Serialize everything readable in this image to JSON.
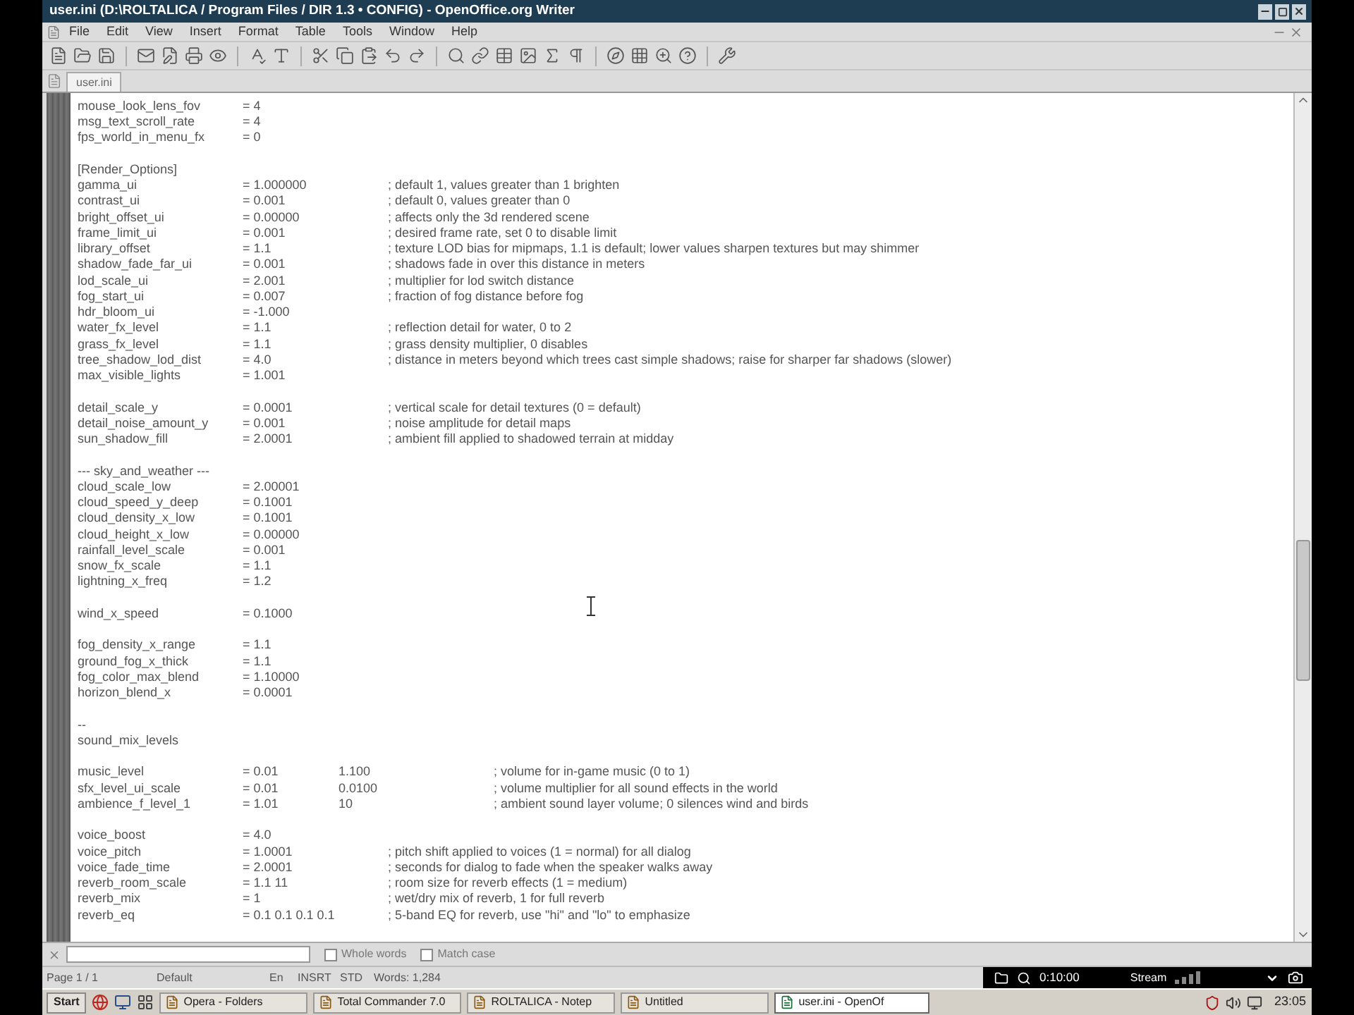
{
  "window": {
    "title": "user.ini (D:\\ROLTALICA / Program Files / DIR 1.3 • CONFIG) - OpenOffice.org Writer"
  },
  "menu": [
    "File",
    "Edit",
    "View",
    "Insert",
    "Format",
    "Table",
    "Tools",
    "Window",
    "Help"
  ],
  "tabs": [
    {
      "label": "user.ini",
      "selected": true
    }
  ],
  "document": {
    "blocks": [
      {
        "lines": [
          {
            "kind": "setting",
            "key": "mouse_look_lens_fov",
            "value": "= 4"
          },
          {
            "kind": "setting",
            "key": "msg_text_scroll_rate",
            "value": "= 4"
          },
          {
            "kind": "setting",
            "key": "fps_world_in_menu_fx",
            "value": "= 0"
          }
        ]
      },
      {
        "lines": [
          {
            "kind": "header",
            "text": "[Render_Options]"
          },
          {
            "kind": "setting",
            "key": "gamma_ui",
            "value": "= 1.000000",
            "comment": "; default 1, values greater than 1 brighten"
          },
          {
            "kind": "setting",
            "key": "contrast_ui",
            "value": "= 0.001",
            "comment": "; default 0, values greater than 0"
          },
          {
            "kind": "setting",
            "key": "bright_offset_ui",
            "value": "= 0.00000",
            "comment": "; affects only the 3d rendered scene"
          },
          {
            "kind": "setting",
            "key": "frame_limit_ui",
            "value": "= 0.001",
            "comment": "; desired frame rate, set 0 to disable limit"
          },
          {
            "kind": "setting",
            "key": "library_offset",
            "value": "= 1.1",
            "comment": "; texture LOD bias for mipmaps, 1.1 is default; lower values sharpen textures but may shimmer"
          },
          {
            "kind": "setting",
            "key": "shadow_fade_far_ui",
            "value": "= 0.001",
            "comment": "; shadows fade in over this distance in meters"
          },
          {
            "kind": "setting",
            "key": "lod_scale_ui",
            "value": "= 2.001",
            "comment": "; multiplier for lod switch distance"
          },
          {
            "kind": "setting",
            "key": "fog_start_ui",
            "value": "= 0.007",
            "comment": "; fraction of fog distance before fog"
          },
          {
            "kind": "setting",
            "key": "hdr_bloom_ui",
            "value": "= -1.000"
          },
          {
            "kind": "setting",
            "key": "water_fx_level",
            "value": "= 1.1",
            "comment": "; reflection detail for water, 0 to 2"
          },
          {
            "kind": "setting",
            "key": "grass_fx_level",
            "value": "= 1.1",
            "comment": "; grass density multiplier, 0 disables"
          },
          {
            "kind": "setting",
            "key": "tree_shadow_lod_dist",
            "value": "= 4.0",
            "comment": "; distance in meters beyond which trees cast simple shadows; raise for sharper far shadows (slower)"
          },
          {
            "kind": "setting",
            "key": "max_visible_lights",
            "value": "= 1.001"
          }
        ]
      },
      {
        "lines": [
          {
            "kind": "setting",
            "key": "detail_scale_y",
            "value": "= 0.0001",
            "comment": "; vertical scale for detail textures (0 = default)"
          },
          {
            "kind": "setting",
            "key": "detail_noise_amount_y",
            "value": "= 0.001",
            "comment": "; noise amplitude for detail maps"
          },
          {
            "kind": "setting",
            "key": "sun_shadow_fill",
            "value": "= 2.0001",
            "comment": "; ambient fill applied to shadowed terrain at midday"
          }
        ]
      },
      {
        "lines": [
          {
            "kind": "text",
            "text": "--- sky_and_weather ---"
          },
          {
            "kind": "setting",
            "key": "cloud_scale_low",
            "value": "= 2.00001"
          },
          {
            "kind": "setting",
            "key": "cloud_speed_y_deep",
            "value": "= 0.1001"
          },
          {
            "kind": "setting",
            "key": "cloud_density_x_low",
            "value": "= 0.1001"
          },
          {
            "kind": "setting",
            "key": "cloud_height_x_low",
            "value": "= 0.00000"
          },
          {
            "kind": "setting",
            "key": "rainfall_level_scale",
            "value": "= 0.001"
          },
          {
            "kind": "setting",
            "key": "snow_fx_scale",
            "value": "= 1.1"
          },
          {
            "kind": "setting",
            "key": "lightning_x_freq",
            "value": "= 1.2"
          }
        ]
      },
      {
        "lines": [
          {
            "kind": "setting",
            "key": "wind_x_speed",
            "value": "= 0.1000"
          }
        ]
      },
      {
        "lines": [
          {
            "kind": "setting",
            "key": "fog_density_x_range",
            "value": "= 1.1"
          },
          {
            "kind": "setting",
            "key": "ground_fog_x_thick",
            "value": "= 1.1"
          },
          {
            "kind": "setting",
            "key": "fog_color_max_blend",
            "value": "= 1.10000"
          },
          {
            "kind": "setting",
            "key": "horizon_blend_x",
            "value": "= 0.0001"
          }
        ]
      },
      {
        "lines": [
          {
            "kind": "text",
            "text": "--"
          },
          {
            "kind": "text",
            "text": "sound_mix_levels"
          }
        ]
      },
      {
        "lines": [
          {
            "kind": "setting",
            "key": "music_level",
            "value": "= 0.01",
            "extra": "1.100",
            "comment": "; volume for in-game music (0 to 1)"
          },
          {
            "kind": "setting",
            "key": "sfx_level_ui_scale",
            "value": "= 0.01",
            "extra": "0.0100",
            "comment": "; volume multiplier for all sound effects in the world"
          },
          {
            "kind": "setting",
            "key": "ambience_f_level_1",
            "value": "= 1.01",
            "extra": "10",
            "comment": "; ambient sound layer volume; 0 silences wind and birds"
          }
        ]
      },
      {
        "lines": [
          {
            "kind": "setting",
            "key": "voice_boost",
            "value": "= 4.0"
          },
          {
            "kind": "setting",
            "key": "voice_pitch",
            "value": "= 1.0001",
            "comment": "; pitch shift applied to voices (1 = normal) for all dialog"
          },
          {
            "kind": "setting",
            "key": "voice_fade_time",
            "value": "= 2.0001",
            "comment": "; seconds for dialog to fade when the speaker walks away"
          },
          {
            "kind": "setting",
            "key": "reverb_room_scale",
            "value": "= 1.1  11",
            "comment": "; room size for reverb effects (1 = medium)"
          },
          {
            "kind": "setting",
            "key": "reverb_mix",
            "value": "= 1",
            "comment": "; wet/dry mix of reverb, 1 for full reverb"
          },
          {
            "kind": "setting",
            "key": "reverb_eq",
            "value": "= 0.1 0.1 0.1 0.1",
            "comment": "; 5-band EQ for reverb, use \"hi\" and \"lo\" to emphasize"
          }
        ]
      }
    ]
  },
  "find_bar": {
    "options": [
      {
        "label": "Whole words",
        "checked": false
      },
      {
        "label": "Match case",
        "checked": false
      }
    ]
  },
  "status_bar": {
    "page": "Page 1 / 1",
    "style": "Default",
    "language": "En",
    "mode": "INSRT",
    "selection": "STD",
    "word_count": "Words: 1,284"
  },
  "recorder": {
    "time": "0:10:00",
    "label": "Stream"
  },
  "taskbar": {
    "start": "Start",
    "tasks": [
      {
        "label": "Opera - Folders",
        "selected": false
      },
      {
        "label": "Total Commander 7.0",
        "selected": false
      },
      {
        "label": "ROLTALICA - Notep",
        "selected": false
      },
      {
        "label": "Untitled",
        "selected": false
      },
      {
        "label": "user.ini - OpenOf",
        "selected": true
      }
    ],
    "clock": "23:05"
  }
}
